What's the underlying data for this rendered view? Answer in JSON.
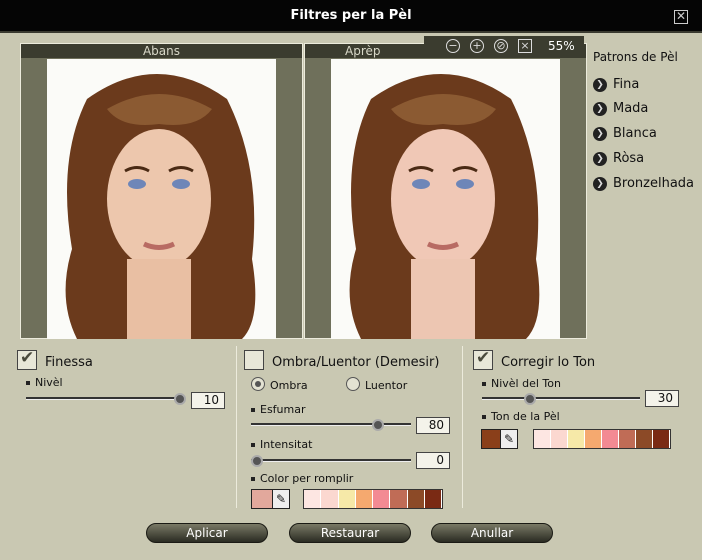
{
  "window": {
    "title": "Filtres per la Pèl"
  },
  "preview": {
    "before_label": "Abans",
    "after_label": "Aprèp",
    "zoom": "55%"
  },
  "presets": {
    "title": "Patrons de Pèl",
    "items": [
      "Fina",
      "Mada",
      "Blanca",
      "Ròsa",
      "Bronzelhada"
    ]
  },
  "finessa": {
    "label": "Finessa",
    "level_label": "Nivèl",
    "level": "10",
    "checked": true
  },
  "ombra": {
    "label": "Ombra/Luentor (Demesir)",
    "checked": false,
    "radio_ombra": "Ombra",
    "radio_luentor": "Luentor",
    "blur_label": "Esfumar",
    "blur": "80",
    "intensity_label": "Intensitat",
    "intensity": "0",
    "fill_label": "Color per romplir",
    "fill_color": "#e2a89c",
    "palette": [
      "#fde6e2",
      "#fbd8d0",
      "#f6e9a8",
      "#f5a96f",
      "#f38a93",
      "#c06c56",
      "#8c4a27",
      "#7a2a14"
    ]
  },
  "tone": {
    "label": "Corregir lo Ton",
    "checked": true,
    "level_label": "Nivèl del Ton",
    "level": "30",
    "skin_label": "Ton de la Pèl",
    "skin_color": "#8a3f1a",
    "palette": [
      "#fde6e2",
      "#fbd8d0",
      "#f6e9a8",
      "#f5a96f",
      "#f38a93",
      "#c06c56",
      "#8c4a27",
      "#7a2a14"
    ]
  },
  "buttons": {
    "apply": "Aplicar",
    "restore": "Restaurar",
    "cancel": "Anullar"
  },
  "icons": [
    "close-icon",
    "zoom-out-icon",
    "zoom-in-icon",
    "zoom-reset-icon",
    "fit-icon",
    "bullet-arrow-icon",
    "checkmark-icon",
    "eyedropper-icon"
  ]
}
